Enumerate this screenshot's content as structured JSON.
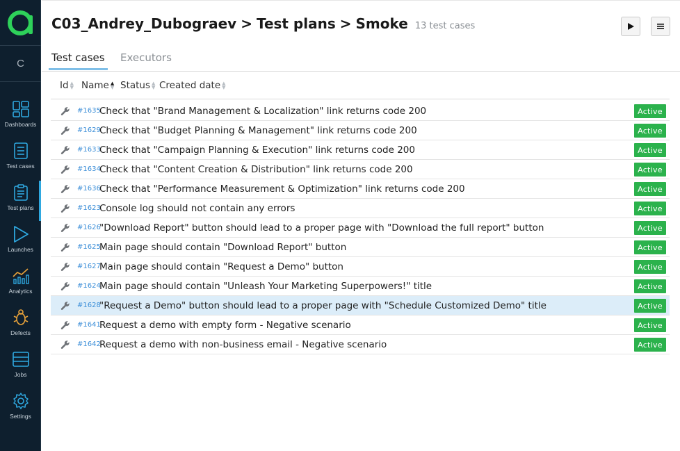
{
  "project_letter": "C",
  "nav": [
    {
      "label": "Dashboards",
      "icon": "dashboards-icon"
    },
    {
      "label": "Test cases",
      "icon": "test-cases-icon"
    },
    {
      "label": "Test plans",
      "icon": "test-plans-icon"
    },
    {
      "label": "Launches",
      "icon": "launches-icon"
    },
    {
      "label": "Analytics",
      "icon": "analytics-icon"
    },
    {
      "label": "Defects",
      "icon": "defects-icon"
    },
    {
      "label": "Jobs",
      "icon": "jobs-icon"
    },
    {
      "label": "Settings",
      "icon": "settings-icon"
    }
  ],
  "header": {
    "project": "C03_Andrey_Dubograev",
    "section": "Test plans",
    "plan": "Smoke",
    "count_text": "13 test cases"
  },
  "tabs": [
    "Test cases",
    "Executors"
  ],
  "columns": [
    "Id",
    "Name",
    "Status",
    "Created date"
  ],
  "rows": [
    {
      "id": "#1635",
      "name": "Check that \"Brand Management & Localization\" link returns code 200",
      "status": "Active"
    },
    {
      "id": "#1629",
      "name": "Check that \"Budget Planning & Management\" link returns code 200",
      "status": "Active"
    },
    {
      "id": "#1633",
      "name": "Check that \"Campaign Planning & Execution\" link returns code 200",
      "status": "Active"
    },
    {
      "id": "#1634",
      "name": "Check that \"Content Creation & Distribution\" link returns code 200",
      "status": "Active"
    },
    {
      "id": "#1636",
      "name": "Check that \"Performance Measurement & Optimization\" link returns code 200",
      "status": "Active"
    },
    {
      "id": "#1623",
      "name": "Console log should not contain any errors",
      "status": "Active"
    },
    {
      "id": "#1626",
      "name": "\"Download Report\" button should lead to a proper page with \"Download the full report\" button",
      "status": "Active"
    },
    {
      "id": "#1625",
      "name": "Main page should contain \"Download Report\" button",
      "status": "Active"
    },
    {
      "id": "#1627",
      "name": "Main page should contain \"Request a Demo\" button",
      "status": "Active"
    },
    {
      "id": "#1624",
      "name": "Main page should contain \"Unleash Your Marketing Superpowers!\" title",
      "status": "Active"
    },
    {
      "id": "#1628",
      "name": "\"Request a Demo\" button should lead to a proper page with \"Schedule Customized Demo\" title",
      "status": "Active"
    },
    {
      "id": "#1641",
      "name": "Request a demo with empty form - Negative scenario",
      "status": "Active"
    },
    {
      "id": "#1642",
      "name": "Request a demo with non-business email - Negative scenario",
      "status": "Active"
    }
  ],
  "colors": {
    "sidebar_bg": "#0e1f2e",
    "logo_green": "#2ed15a",
    "active_badge": "#2bb24c",
    "id_link": "#3b8ed8",
    "row_highlight": "#dcedf9"
  }
}
